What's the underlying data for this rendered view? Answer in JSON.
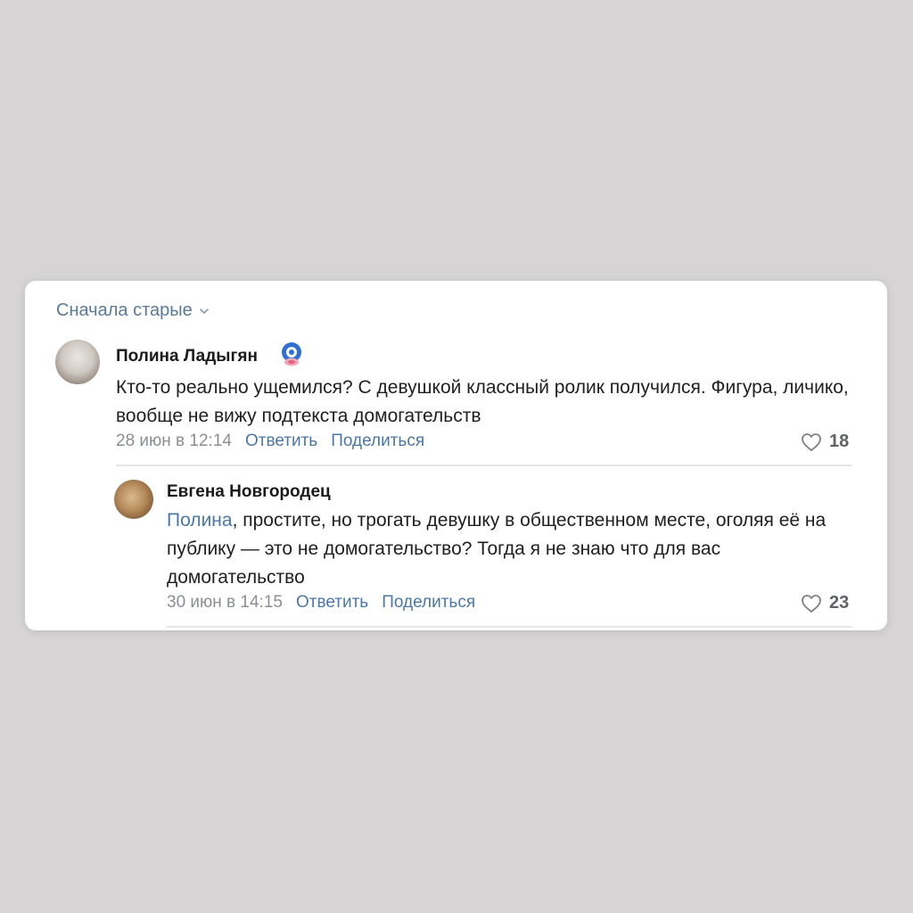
{
  "sort": {
    "label": "Сначала старые",
    "icon": "chevron-down-icon"
  },
  "comments": [
    {
      "author": "Полина Ладыгян",
      "badge_icon": "sticker-badge-icon",
      "text": "Кто-то реально ущемился? С девушкой классный ролик получился. Фигура, личико, вообще не вижу подтекста домогательств",
      "date": "28 июн в 12:14",
      "reply_label": "Ответить",
      "share_label": "Поделиться",
      "likes": "18",
      "like_icon": "heart-icon"
    },
    {
      "author": "Евгена Новгородец",
      "mention": "Полина",
      "text": ", простите, но трогать девушку в общественном месте, оголяя её на публику — это не домогательство? Тогда я не знаю что для вас домогательство",
      "date": "30 июн в 14:15",
      "reply_label": "Ответить",
      "share_label": "Поделиться",
      "likes": "23",
      "like_icon": "heart-icon"
    }
  ],
  "colors": {
    "background": "#d6d4d4",
    "card": "#ffffff",
    "link": "#4a78a8",
    "meta": "#8a8f96"
  }
}
